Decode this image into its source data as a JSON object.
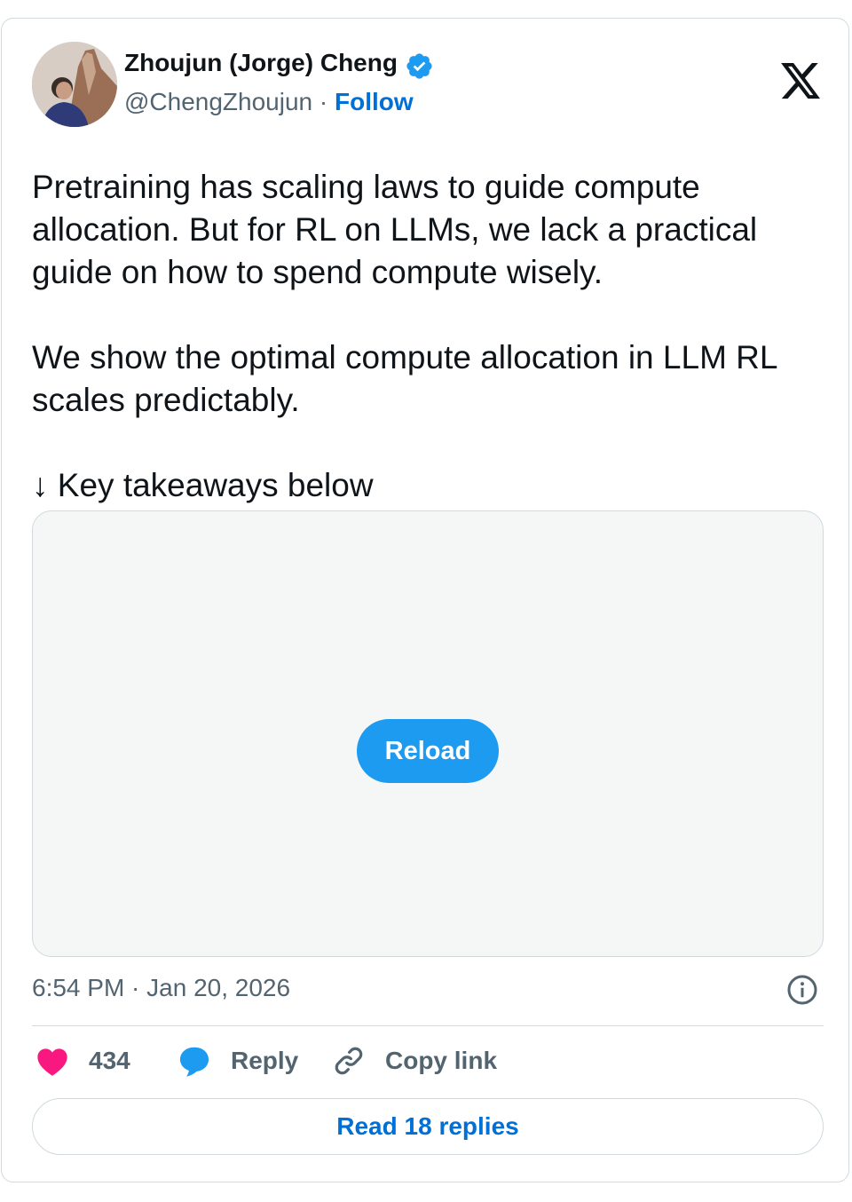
{
  "author": {
    "name": "Zhoujun (Jorge) Cheng",
    "handle": "@ChengZhoujun",
    "separator": "·",
    "follow_label": "Follow",
    "verified": true
  },
  "tweet": {
    "paragraphs": [
      "Pretraining has scaling laws to guide compute allocation. But for RL on LLMs, we lack a practical guide on how to spend compute wisely.",
      "We show the optimal compute allocation in LLM RL scales predictably.",
      "↓ Key takeaways below"
    ]
  },
  "media": {
    "reload_label": "Reload"
  },
  "meta": {
    "timestamp": "6:54 PM · Jan 20, 2026"
  },
  "actions": {
    "like_count": "434",
    "reply_label": "Reply",
    "copy_link_label": "Copy link"
  },
  "read_replies_label": "Read 18 replies",
  "colors": {
    "accent": "#1d9bf0",
    "link": "#006fd6",
    "like": "#f91880",
    "text": "#0f1419",
    "muted": "#536471",
    "border": "#cfd9de"
  },
  "icons": {
    "logo": "x-logo-icon",
    "verified": "verified-badge-icon",
    "info": "info-icon",
    "like": "heart-icon",
    "reply": "speech-bubble-icon",
    "copy": "link-icon"
  }
}
